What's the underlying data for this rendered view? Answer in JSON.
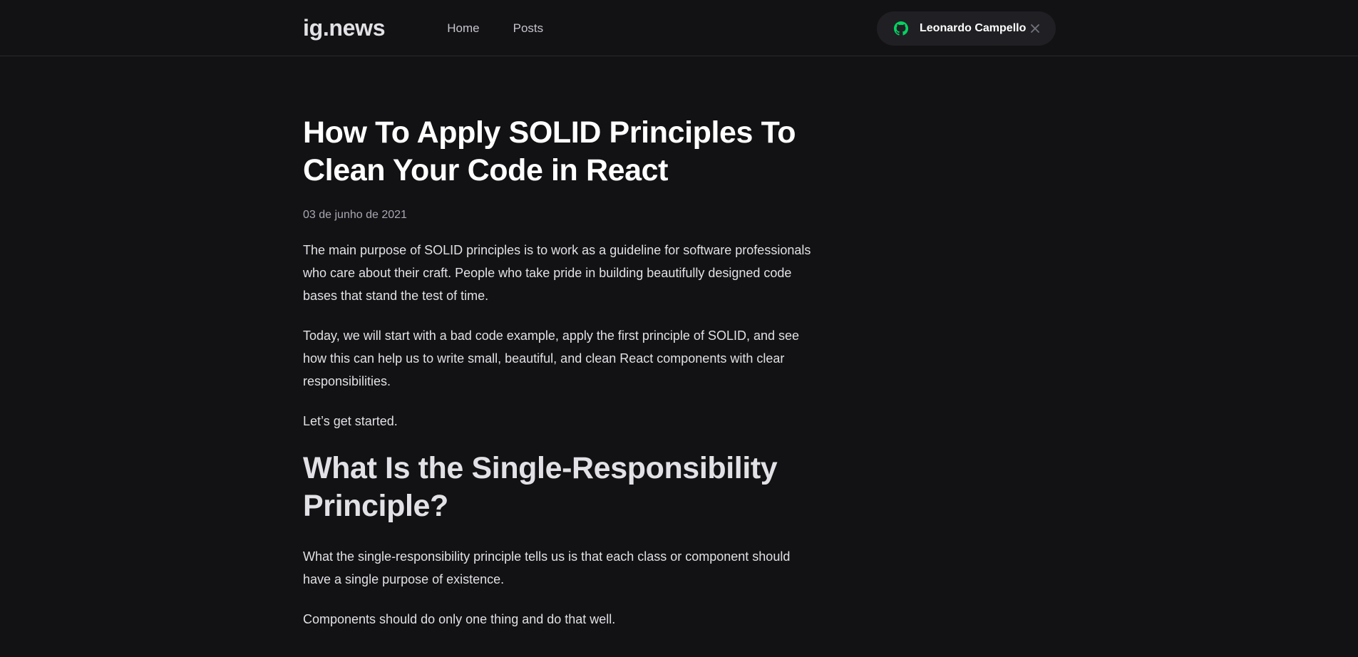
{
  "header": {
    "logo": "ig.news",
    "nav": [
      {
        "label": "Home"
      },
      {
        "label": "Posts"
      }
    ],
    "user": {
      "name": "Leonardo Campello",
      "icon": "github-icon",
      "close_icon": "close-icon",
      "accent": "#04d361"
    }
  },
  "post": {
    "title": "How To Apply SOLID Principles To Clean Your Code in React",
    "date": "03 de junho de 2021",
    "paragraphs": [
      "The main purpose of SOLID principles is to work as a guideline for software professionals who care about their craft. People who take pride in building beautifully designed code bases that stand the test of time.",
      "Today, we will start with a bad code example, apply the first principle of SOLID, and see how this can help us to write small, beautiful, and clean React components with clear responsibilities.",
      "Let’s get started."
    ],
    "section_heading": "What Is the Single-Responsibility Principle?",
    "section_paragraphs": [
      "What the single-responsibility principle tells us is that each class or component should have a single purpose of existence.",
      "Components should do only one thing and do that well."
    ]
  },
  "colors": {
    "background": "#121214",
    "header_border": "#29292e",
    "button_bg": "#202024",
    "text": "#e1e1e6",
    "muted": "#a8a8b3"
  }
}
